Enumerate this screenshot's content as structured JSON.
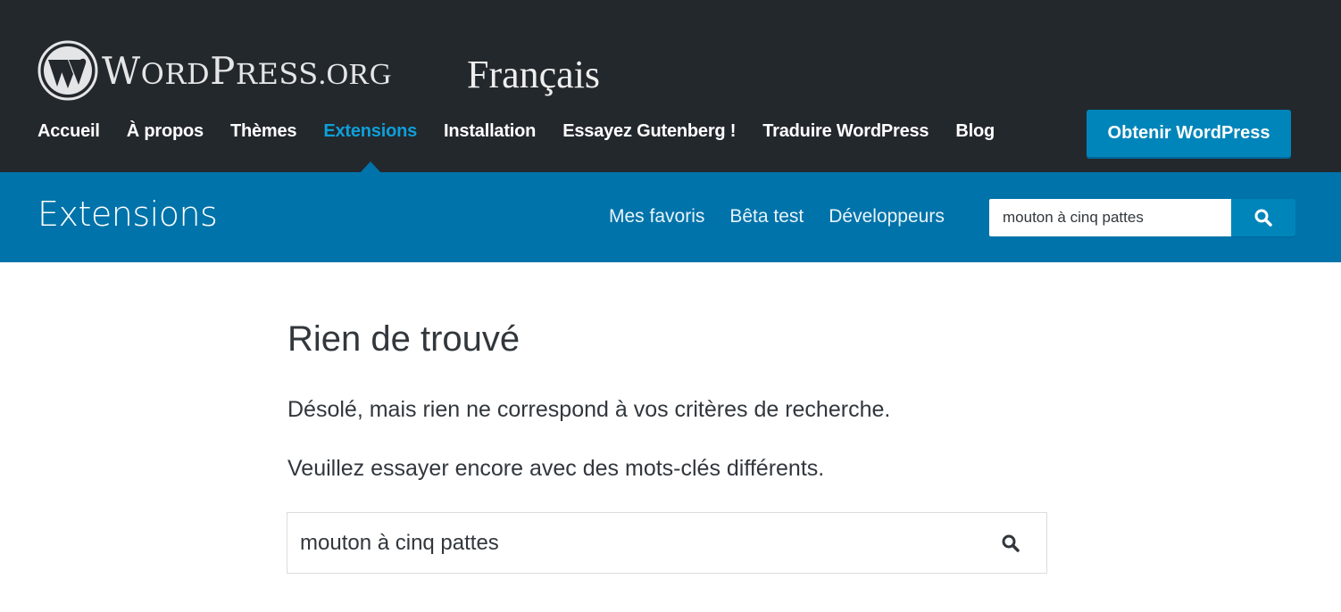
{
  "header": {
    "logo_main": "WORDPRESS",
    "logo_suffix": ".ORG",
    "locale": "Français",
    "nav": [
      {
        "label": "Accueil",
        "active": false
      },
      {
        "label": "À propos",
        "active": false
      },
      {
        "label": "Thèmes",
        "active": false
      },
      {
        "label": "Extensions",
        "active": true
      },
      {
        "label": "Installation",
        "active": false
      },
      {
        "label": "Essayez Gutenberg !",
        "active": false
      },
      {
        "label": "Traduire WordPress",
        "active": false
      },
      {
        "label": "Blog",
        "active": false
      }
    ],
    "cta_label": "Obtenir WordPress"
  },
  "section": {
    "title": "Extensions",
    "nav": [
      "Mes favoris",
      "Bêta test",
      "Développeurs"
    ],
    "search_value": "mouton à cinq pattes",
    "search_icon": "search-icon"
  },
  "main": {
    "title": "Rien de trouvé",
    "message1": "Désolé, mais rien ne correspond à vos critères de recherche.",
    "message2": "Veuillez essayer encore avec des mots-clés différents.",
    "search_value": "mouton à cinq pattes",
    "search_icon": "search-icon"
  },
  "colors": {
    "header_bg": "#23282d",
    "section_bg": "#0073aa",
    "accent": "#0085ba",
    "active_link": "#0e9fd9",
    "text": "#32373c"
  }
}
